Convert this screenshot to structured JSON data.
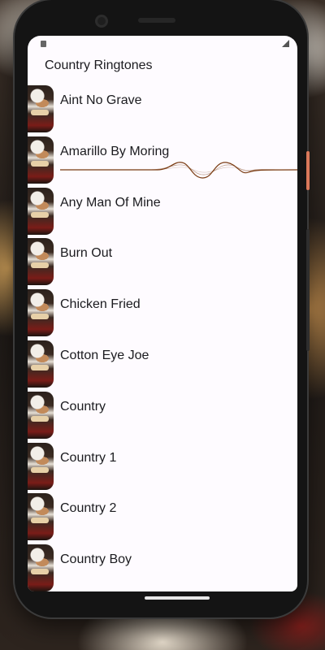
{
  "app": {
    "title": "Country Ringtones"
  },
  "ringtones": [
    {
      "label": "Aint No Grave",
      "playing": false
    },
    {
      "label": "Amarillo By Moring",
      "playing": true
    },
    {
      "label": "Any Man Of Mine",
      "playing": false
    },
    {
      "label": "Burn Out",
      "playing": false
    },
    {
      "label": "Chicken Fried",
      "playing": false
    },
    {
      "label": "Cotton Eye Joe",
      "playing": false
    },
    {
      "label": "Country",
      "playing": false
    },
    {
      "label": "Country 1",
      "playing": false
    },
    {
      "label": "Country 2",
      "playing": false
    },
    {
      "label": "Country Boy",
      "playing": false
    }
  ],
  "colors": {
    "accent": "#d9785a",
    "wave": "#7a3b12",
    "screen_bg": "#fefbff"
  }
}
